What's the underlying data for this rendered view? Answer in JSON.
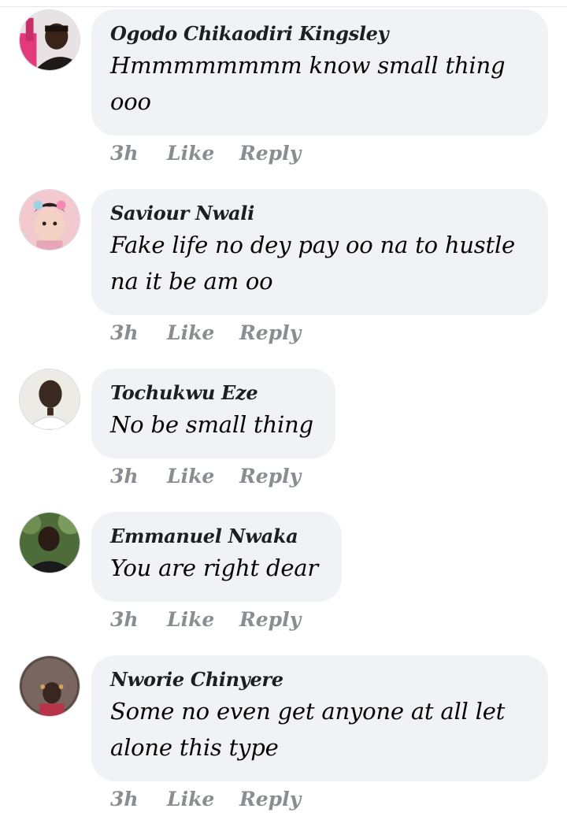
{
  "comments": [
    {
      "author": "Ogodo Chikaodiri Kingsley",
      "text": "Hmmmmmmmm know small thing ooo",
      "time": "3h",
      "like_label": "Like",
      "reply_label": "Reply"
    },
    {
      "author": "Saviour Nwali",
      "text": "Fake life no dey pay oo na to hustle na it be am oo",
      "time": "3h",
      "like_label": "Like",
      "reply_label": "Reply"
    },
    {
      "author": "Tochukwu Eze",
      "text": "No be small thing",
      "time": "3h",
      "like_label": "Like",
      "reply_label": "Reply"
    },
    {
      "author": "Emmanuel Nwaka",
      "text": "You are right dear",
      "time": "3h",
      "like_label": "Like",
      "reply_label": "Reply"
    },
    {
      "author": "Nworie Chinyere",
      "text": "Some no even get anyone at all let alone this type",
      "time": "3h",
      "like_label": "Like",
      "reply_label": "Reply"
    }
  ],
  "colors": {
    "bubble_bg": "#f0f2f5",
    "author_text": "#1c1e21",
    "comment_text": "#050505",
    "meta_text": "#8a8d91"
  }
}
